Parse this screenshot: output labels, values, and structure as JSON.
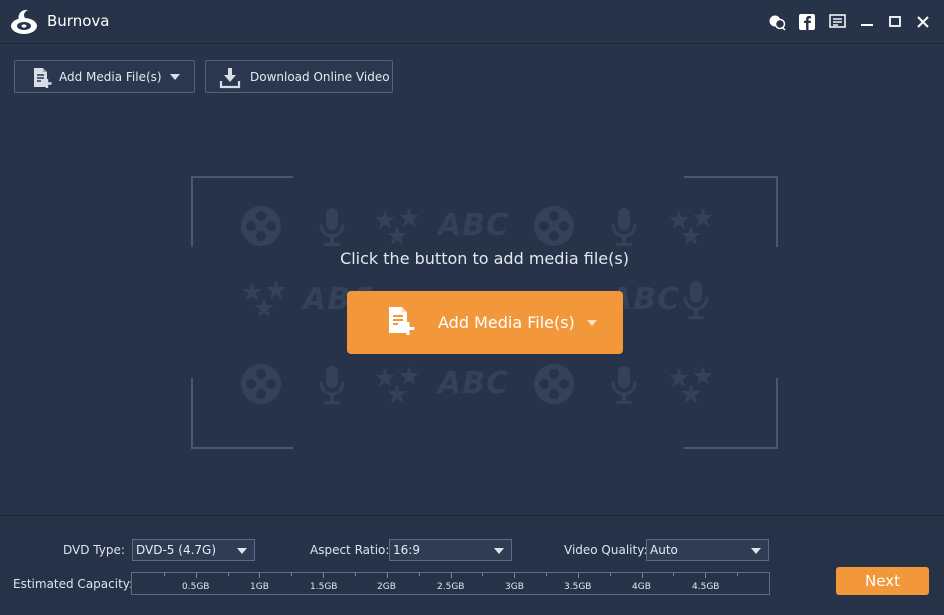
{
  "app": {
    "title": "Burnova"
  },
  "window_controls": [
    "feedback-icon",
    "facebook-icon",
    "menu-icon",
    "minimize-icon",
    "maximize-icon",
    "close-icon"
  ],
  "toolbar": {
    "add_media_label": "Add Media File(s)",
    "download_label": "Download Online Video"
  },
  "dropzone": {
    "hint": "Click the button to add media file(s)",
    "add_button_label": "Add Media File(s)",
    "decor_text": "ABC"
  },
  "settings": {
    "dvd_type_label": "DVD Type:",
    "dvd_type_value": "DVD-5 (4.7G)",
    "aspect_ratio_label": "Aspect Ratio:",
    "aspect_ratio_value": "16:9",
    "video_quality_label": "Video Quality:",
    "video_quality_value": "Auto",
    "capacity_label": "Estimated Capacity:",
    "capacity_ticks": [
      "0.5GB",
      "1GB",
      "1.5GB",
      "2GB",
      "2.5GB",
      "3GB",
      "3.5GB",
      "4GB",
      "4.5GB"
    ],
    "capacity_used_fraction": 0
  },
  "next_label": "Next",
  "colors": {
    "background": "#263349",
    "accent": "#f2973a"
  }
}
